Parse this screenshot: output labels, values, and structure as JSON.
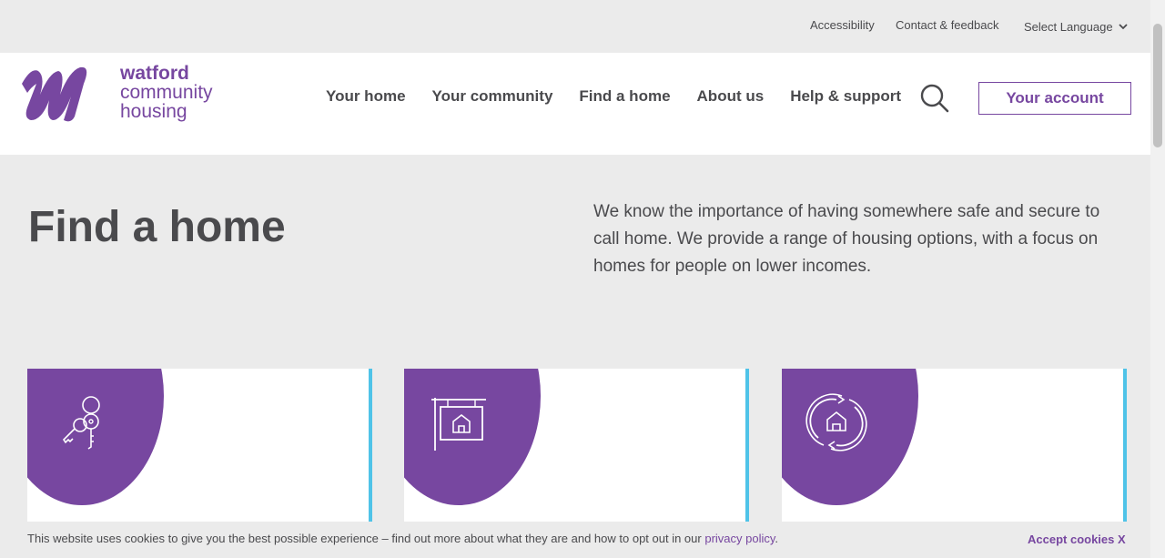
{
  "utility": {
    "accessibility": "Accessibility",
    "contact": "Contact & feedback",
    "language": "Select Language"
  },
  "logo": {
    "line1": "watford",
    "line2": "community",
    "line3": "housing"
  },
  "nav": {
    "items": [
      {
        "label": "Your home"
      },
      {
        "label": "Your community"
      },
      {
        "label": "Find a home"
      },
      {
        "label": "About us"
      },
      {
        "label": "Help & support"
      }
    ],
    "account": "Your account"
  },
  "hero": {
    "title": "Find a home",
    "intro": "We know the importance of having somewhere safe and secure to call home. We provide a range of housing options, with a focus on homes for people on lower incomes."
  },
  "cards": [
    {
      "icon": "keys-icon"
    },
    {
      "icon": "house-sign-icon"
    },
    {
      "icon": "house-exchange-icon"
    }
  ],
  "cookie": {
    "text": "This website uses cookies to give you the best possible experience – find out more about what they are and how to opt out in our ",
    "link": "privacy policy",
    "after": ".",
    "accept": "Accept cookies X"
  },
  "colors": {
    "brand": "#7747a0",
    "accent": "#4fc3e8",
    "text": "#4a4a4d",
    "background": "#ebebeb"
  }
}
